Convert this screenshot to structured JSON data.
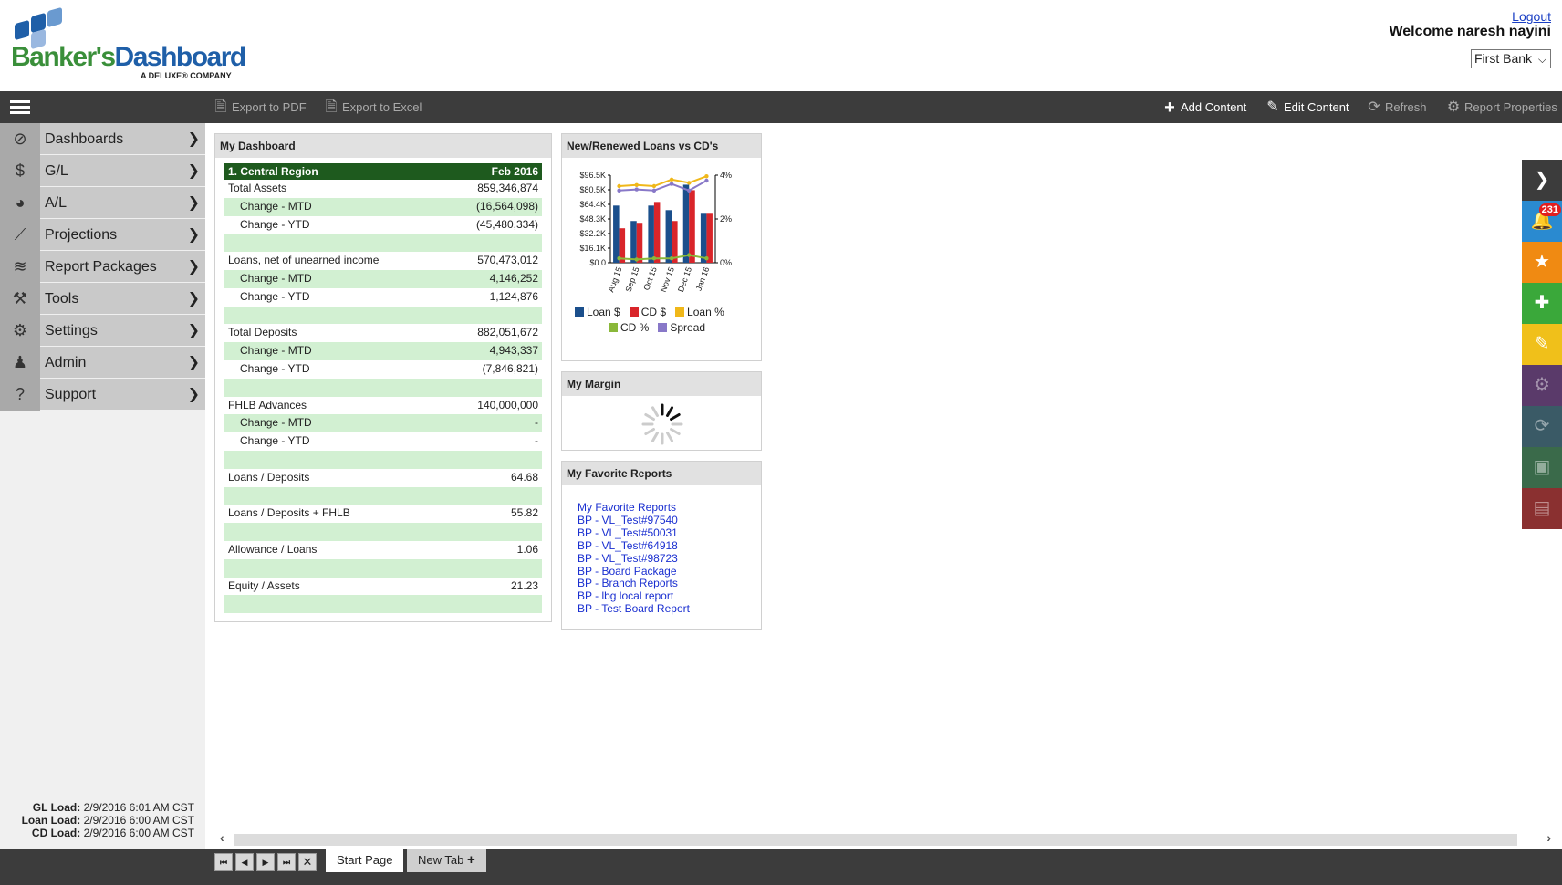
{
  "header": {
    "brand_part1": "Banker's",
    "brand_part2": "Dashboard",
    "tagline": "A DELUXE® COMPANY",
    "logout": "Logout",
    "welcome": "Welcome  naresh nayini",
    "bank_selected": "First Bank"
  },
  "toolbar": {
    "export_pdf": "Export to PDF",
    "export_excel": "Export to Excel",
    "add_content": "Add Content",
    "edit_content": "Edit Content",
    "refresh": "Refresh",
    "report_properties": "Report Properties"
  },
  "sidebar": {
    "items": [
      {
        "label": "Dashboards",
        "icon": "compass-icon"
      },
      {
        "label": "G/L",
        "icon": "dollar-icon"
      },
      {
        "label": "A/L",
        "icon": "pie-icon"
      },
      {
        "label": "Projections",
        "icon": "line-chart-icon"
      },
      {
        "label": "Report Packages",
        "icon": "layers-icon"
      },
      {
        "label": "Tools",
        "icon": "hammer-icon"
      },
      {
        "label": "Settings",
        "icon": "gear-icon"
      },
      {
        "label": "Admin",
        "icon": "user-icon"
      },
      {
        "label": "Support",
        "icon": "question-icon"
      }
    ],
    "loads": [
      {
        "label": "GL Load:",
        "value": "2/9/2016 6:01 AM CST"
      },
      {
        "label": "Loan Load:",
        "value": "2/9/2016 6:00 AM CST"
      },
      {
        "label": "CD Load:",
        "value": "2/9/2016 6:00 AM CST"
      }
    ]
  },
  "my_dashboard": {
    "title": "My Dashboard",
    "region": "1. Central Region",
    "period": "Feb 2016",
    "rows": [
      {
        "label": "Total Assets",
        "value": "859,346,874",
        "sub": false,
        "green": false
      },
      {
        "label": "Change - MTD",
        "value": "(16,564,098)",
        "sub": true,
        "green": true
      },
      {
        "label": "Change - YTD",
        "value": "(45,480,334)",
        "sub": true,
        "green": false
      },
      {
        "label": "",
        "value": "",
        "sub": false,
        "green": true
      },
      {
        "label": "Loans, net of unearned income",
        "value": "570,473,012",
        "sub": false,
        "green": false
      },
      {
        "label": "Change - MTD",
        "value": "4,146,252",
        "sub": true,
        "green": true
      },
      {
        "label": "Change - YTD",
        "value": "1,124,876",
        "sub": true,
        "green": false
      },
      {
        "label": "",
        "value": "",
        "sub": false,
        "green": true
      },
      {
        "label": "Total Deposits",
        "value": "882,051,672",
        "sub": false,
        "green": false
      },
      {
        "label": "Change - MTD",
        "value": "4,943,337",
        "sub": true,
        "green": true
      },
      {
        "label": "Change - YTD",
        "value": "(7,846,821)",
        "sub": true,
        "green": false
      },
      {
        "label": "",
        "value": "",
        "sub": false,
        "green": true
      },
      {
        "label": "FHLB Advances",
        "value": "140,000,000",
        "sub": false,
        "green": false
      },
      {
        "label": "Change - MTD",
        "value": "-",
        "sub": true,
        "green": true
      },
      {
        "label": "Change - YTD",
        "value": "-",
        "sub": true,
        "green": false
      },
      {
        "label": "",
        "value": "",
        "sub": false,
        "green": true
      },
      {
        "label": "Loans / Deposits",
        "value": "64.68",
        "sub": false,
        "green": false
      },
      {
        "label": "",
        "value": "",
        "sub": false,
        "green": true
      },
      {
        "label": "Loans / Deposits + FHLB",
        "value": "55.82",
        "sub": false,
        "green": false
      },
      {
        "label": "",
        "value": "",
        "sub": false,
        "green": true
      },
      {
        "label": "Allowance / Loans",
        "value": "1.06",
        "sub": false,
        "green": false
      },
      {
        "label": "",
        "value": "",
        "sub": false,
        "green": true
      },
      {
        "label": "Equity / Assets",
        "value": "21.23",
        "sub": false,
        "green": false
      },
      {
        "label": "",
        "value": "",
        "sub": false,
        "green": true
      }
    ]
  },
  "loans_panel": {
    "title": "New/Renewed Loans vs CD's"
  },
  "chart_data": {
    "type": "bar",
    "categories": [
      "Aug 15",
      "Sep 15",
      "Oct 15",
      "Nov 15",
      "Dec 15",
      "Jan 16"
    ],
    "y_ticks": [
      "$96.5K",
      "$80.5K",
      "$64.4K",
      "$48.3K",
      "$32.2K",
      "$16.1K",
      "$0.0"
    ],
    "y2_ticks": [
      "4%",
      "2%",
      "0%"
    ],
    "ylim": [
      0,
      96500
    ],
    "y2lim": [
      0,
      4
    ],
    "series": [
      {
        "name": "Loan $",
        "kind": "bar",
        "axis": "left",
        "color": "#1b4f8c",
        "values": [
          63000,
          46000,
          63000,
          58000,
          86000,
          54000
        ]
      },
      {
        "name": "CD $",
        "kind": "bar",
        "axis": "left",
        "color": "#d9252a",
        "values": [
          38000,
          44000,
          67000,
          46000,
          80000,
          54000
        ]
      },
      {
        "name": "Loan %",
        "kind": "line",
        "axis": "right",
        "color": "#f0b81a",
        "values": [
          3.5,
          3.55,
          3.5,
          3.8,
          3.65,
          3.95
        ]
      },
      {
        "name": "CD %",
        "kind": "line",
        "axis": "right",
        "color": "#8ab83a",
        "values": [
          0.2,
          0.15,
          0.2,
          0.2,
          0.35,
          0.2
        ]
      },
      {
        "name": "Spread",
        "kind": "line",
        "axis": "right",
        "color": "#8878c8",
        "values": [
          3.3,
          3.35,
          3.3,
          3.6,
          3.3,
          3.75
        ]
      }
    ],
    "legend_rows": [
      [
        "Loan $",
        "CD $",
        "Loan %"
      ],
      [
        "CD %",
        "Spread"
      ]
    ]
  },
  "margin_panel": {
    "title": "My Margin"
  },
  "favorites": {
    "title": "My Favorite Reports",
    "links": [
      "My Favorite Reports",
      "BP - VL_Test#97540",
      "BP - VL_Test#50031",
      "BP - VL_Test#64918",
      "BP - VL_Test#98723",
      "BP - Board Package",
      "BP - Branch Reports",
      "BP - lbg local report",
      "BP - Test Board Report"
    ]
  },
  "right_bar": {
    "notification_count": "231",
    "buttons": [
      {
        "name": "collapse-arrow-icon",
        "color": "#3c3c3c",
        "glyph": "❯"
      },
      {
        "name": "bell-icon",
        "color": "#2a8ad0",
        "glyph": "🔔"
      },
      {
        "name": "star-icon",
        "color": "#f08a12",
        "glyph": "★"
      },
      {
        "name": "plus-icon",
        "color": "#3aa83a",
        "glyph": "✚"
      },
      {
        "name": "pencil-icon",
        "color": "#f0c01a",
        "glyph": "✎"
      },
      {
        "name": "gear-icon",
        "color": "#5a3a6a",
        "glyph": "⚙"
      },
      {
        "name": "refresh-icon",
        "color": "#3a5a66",
        "glyph": "⟳"
      },
      {
        "name": "excel-icon",
        "color": "#3a6a4a",
        "glyph": "▣"
      },
      {
        "name": "pdf-icon",
        "color": "#8a3030",
        "glyph": "▤"
      }
    ]
  },
  "tabs": {
    "start_page": "Start Page",
    "new_tab": "New Tab"
  }
}
